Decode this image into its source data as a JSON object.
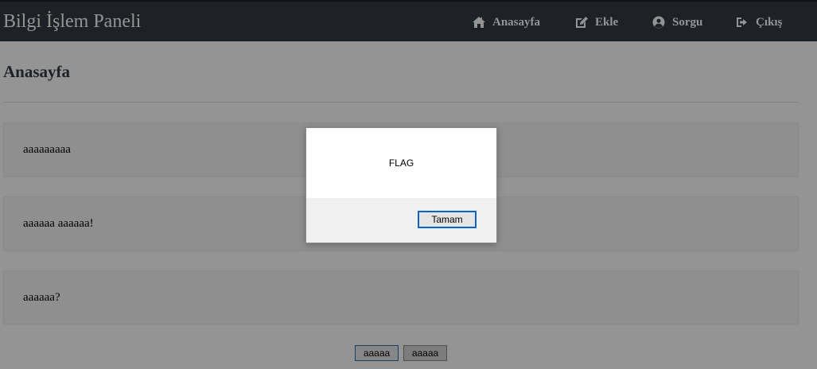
{
  "navbar": {
    "brand": "Bilgi İşlem Paneli",
    "items": [
      {
        "label": "Anasayfa",
        "icon": "home-icon"
      },
      {
        "label": "Ekle",
        "icon": "edit-icon"
      },
      {
        "label": "Sorgu",
        "icon": "user-circle-icon"
      },
      {
        "label": "Çıkış",
        "icon": "sign-out-icon"
      }
    ],
    "background": "#343a40"
  },
  "main": {
    "title": "Anasayfa",
    "cards": [
      {
        "text": "aaaaaaaaa"
      },
      {
        "text": "aaaaaa aaaaaa!"
      },
      {
        "text": "aaaaaa?"
      }
    ],
    "pagination": [
      {
        "label": "aaaaa",
        "active": true
      },
      {
        "label": "aaaaa",
        "active": false
      }
    ]
  },
  "dialog": {
    "message": "FLAG",
    "ok_label": "Tamam",
    "accent": "#0a64c8"
  }
}
